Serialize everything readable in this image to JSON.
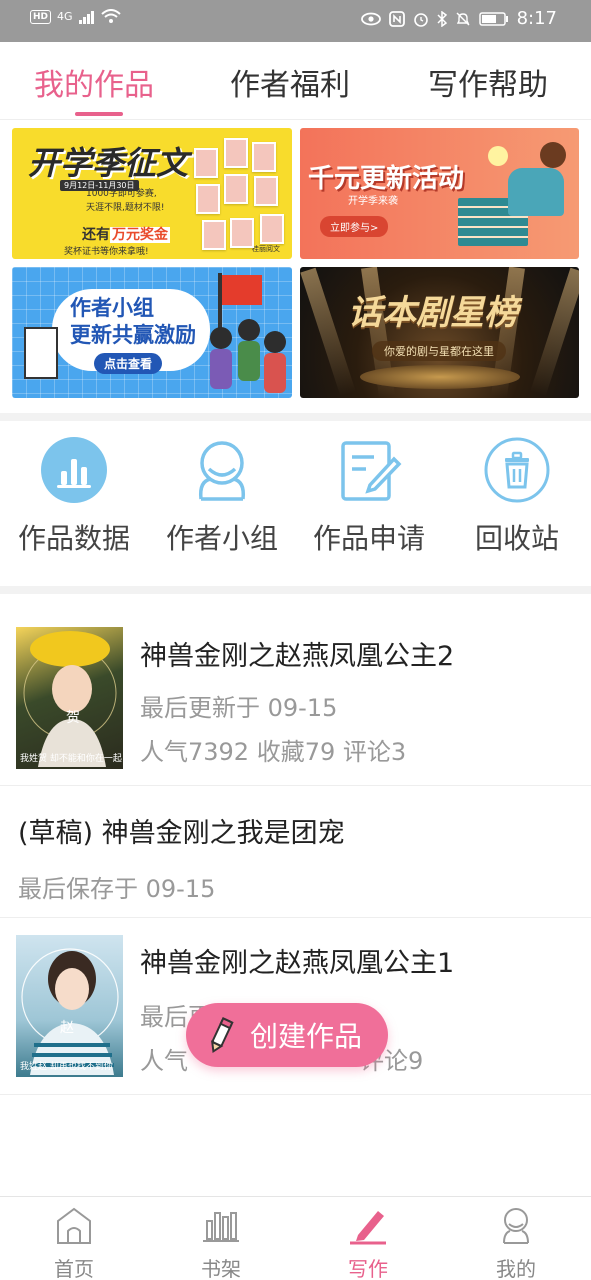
{
  "status_bar": {
    "left": [
      "HD",
      "4G"
    ],
    "time": "8:17"
  },
  "tabs": [
    {
      "label": "我的作品",
      "active": true
    },
    {
      "label": "作者福利",
      "active": false
    },
    {
      "label": "写作帮助",
      "active": false
    }
  ],
  "banners": {
    "b1": {
      "title": "开学季征文",
      "date": "9月12日-11月30日",
      "line1": "1000字即可参赛,",
      "line2": "天涯不限,题材不限!",
      "big_pre": "还有",
      "big_hl": "万元奖金",
      "line3": "奖杯证书等你来拿哦!",
      "org": "桂丽阅文"
    },
    "b2": {
      "title": "千元更新活动",
      "sub": "开学季来袭",
      "button": "立即参与>"
    },
    "b3": {
      "title_line1": "作者小组",
      "title_line2": "更新共赢激励",
      "button": "点击查看"
    },
    "b4": {
      "title": "话本剧星榜",
      "sub": "你爱的剧与星都在这里"
    }
  },
  "quick_actions": [
    {
      "label": "作品数据",
      "icon": "bar-chart-icon"
    },
    {
      "label": "作者小组",
      "icon": "group-icon"
    },
    {
      "label": "作品申请",
      "icon": "edit-doc-icon"
    },
    {
      "label": "回收站",
      "icon": "trash-icon"
    }
  ],
  "works": [
    {
      "title": "神兽金刚之赵燕凤凰公主2",
      "updated": "最后更新于 09-15",
      "stats": "人气7392 收藏79 评论3",
      "cover_char": "贺",
      "cover_caption": "我姓贺 却不能和你在一起"
    },
    {
      "title": "(草稿) 神兽金刚之我是团宠",
      "updated": "最后保存于 09-15"
    },
    {
      "title": "神兽金刚之赵燕凤凰公主1",
      "updated": "最后更新于 09-15",
      "stats": "人气",
      "stats_tail": "评论9",
      "cover_char": "赵",
      "cover_caption": "我姓赵 却再也找不到你"
    }
  ],
  "fab": {
    "label": "创建作品"
  },
  "bottom_nav": [
    {
      "label": "首页",
      "icon": "home-icon",
      "active": false
    },
    {
      "label": "书架",
      "icon": "bookshelf-icon",
      "active": false
    },
    {
      "label": "写作",
      "icon": "pen-icon",
      "active": true
    },
    {
      "label": "我的",
      "icon": "profile-icon",
      "active": false
    }
  ],
  "colors": {
    "accent": "#e8618c",
    "fab": "#f06f99",
    "icon_blue": "#7cc4ec",
    "muted": "#999999"
  }
}
